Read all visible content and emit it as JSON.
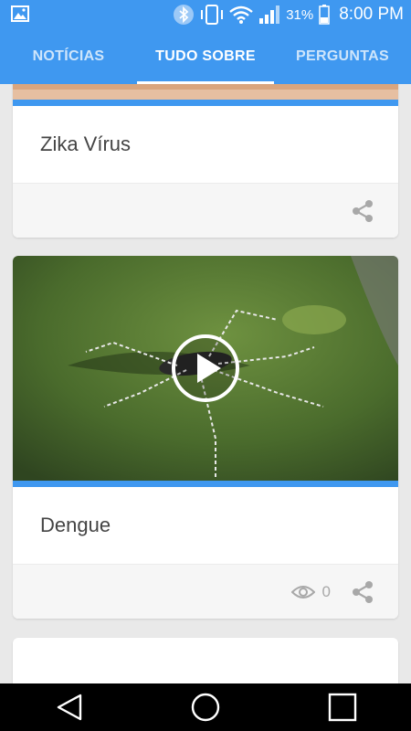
{
  "status_bar": {
    "battery_percent": "31%",
    "time": "8:00 PM",
    "icons": [
      "gallery-icon",
      "bluetooth-icon",
      "vibrate-icon",
      "wifi-icon",
      "signal-icon",
      "battery-icon"
    ]
  },
  "tabs": [
    {
      "label": "NOTÍCIAS",
      "active": false
    },
    {
      "label": "TUDO SOBRE",
      "active": true
    },
    {
      "label": "PERGUNTAS",
      "active": false
    }
  ],
  "cards": [
    {
      "title": "Zika Vírus",
      "share_icon": "share-icon"
    },
    {
      "title": "Dengue",
      "views": "0",
      "has_video": true,
      "share_icon": "share-icon"
    }
  ],
  "colors": {
    "primary": "#3f98f0",
    "card_bg": "#ffffff",
    "page_bg": "#e9e9e9"
  },
  "nav_bar": {
    "icons": [
      "back-icon",
      "home-icon",
      "recents-icon"
    ]
  }
}
